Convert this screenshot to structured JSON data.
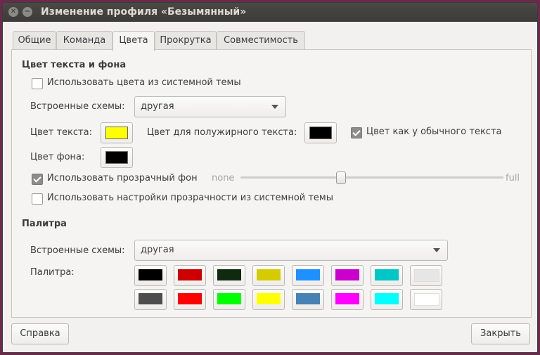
{
  "window": {
    "title": "Изменение профиля «Безымянный»",
    "close_glyph": "✕",
    "min_glyph": "−"
  },
  "tabs": [
    {
      "label": "Общие"
    },
    {
      "label": "Команда"
    },
    {
      "label": "Цвета"
    },
    {
      "label": "Прокрутка"
    },
    {
      "label": "Совместимость"
    }
  ],
  "active_tab": "Цвета",
  "text_bg": {
    "section_title": "Цвет текста и фона",
    "use_system_colors": {
      "label": "Использовать цвета из системной темы",
      "checked": false
    },
    "schemes_label": "Встроенные схемы:",
    "schemes_value": "другая",
    "text_color_label": "Цвет текста:",
    "text_color": "#ffff00",
    "bold_color_label": "Цвет для полужирного текста:",
    "bold_color": "#000000",
    "same_as_text": {
      "label": "Цвет как у обычного текста",
      "checked": true
    },
    "bg_color_label": "Цвет фона:",
    "bg_color": "#000000",
    "transparent_bg": {
      "label": "Использовать прозрачный фон",
      "checked": true
    },
    "slider_min": "none",
    "slider_max": "full",
    "slider_value": 0.38,
    "system_transparency": {
      "label": "Использовать настройки прозрачности из системной темы",
      "checked": false
    }
  },
  "palette": {
    "section_title": "Палитра",
    "schemes_label": "Встроенные схемы:",
    "schemes_value": "другая",
    "palette_label": "Палитра:",
    "colors_row1": [
      "#000000",
      "#cc0000",
      "#0f2a0f",
      "#d4cc00",
      "#1e90ff",
      "#cc00cc",
      "#00c6c6",
      "#e6e6e6"
    ],
    "colors_row2": [
      "#4d4d4d",
      "#ff0000",
      "#00ff00",
      "#ffff00",
      "#4682b4",
      "#ff00ff",
      "#00ffff",
      "#ffffff"
    ]
  },
  "footer": {
    "help_label": "Справка",
    "close_label": "Закрыть"
  }
}
